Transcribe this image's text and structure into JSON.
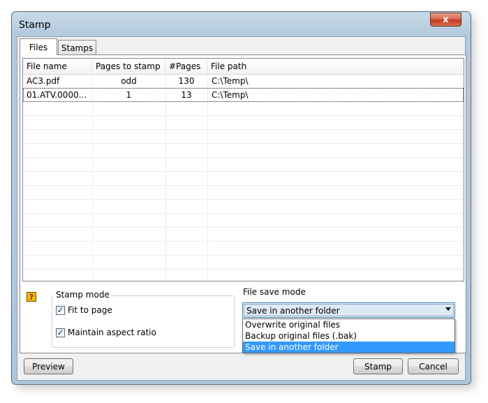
{
  "window": {
    "title": "Stamp",
    "close_glyph": "x"
  },
  "tabs": [
    {
      "label": "Files",
      "active": true
    },
    {
      "label": "Stamps",
      "active": false
    }
  ],
  "file_list": {
    "columns": [
      "File name",
      "Pages to stamp",
      "#Pages",
      "File path"
    ],
    "rows": [
      {
        "file_name": "AC3.pdf",
        "pages_to_stamp": "odd",
        "pages": "130",
        "path": "C:\\Temp\\"
      },
      {
        "file_name": "01.ATV.0000...",
        "pages_to_stamp": "1",
        "pages": "13",
        "path": "C:\\Temp\\"
      }
    ]
  },
  "help": {
    "icon": "help-question-icon",
    "glyph": "?"
  },
  "stamp_mode": {
    "label": "Stamp mode",
    "fit_to_page": {
      "label": "Fit to page",
      "checked": true
    },
    "maintain_aspect": {
      "label": "Maintain aspect ratio",
      "checked": true
    }
  },
  "file_save_mode": {
    "label": "File save mode",
    "selected": "Save in another folder",
    "options": [
      "Overwrite original files",
      "Backup original files (.bak)",
      "Save in another folder"
    ]
  },
  "buttons": {
    "preview": "Preview",
    "stamp": "Stamp",
    "cancel": "Cancel"
  },
  "colors": {
    "selection": "#3399ff",
    "close_button": "#c23a20"
  }
}
